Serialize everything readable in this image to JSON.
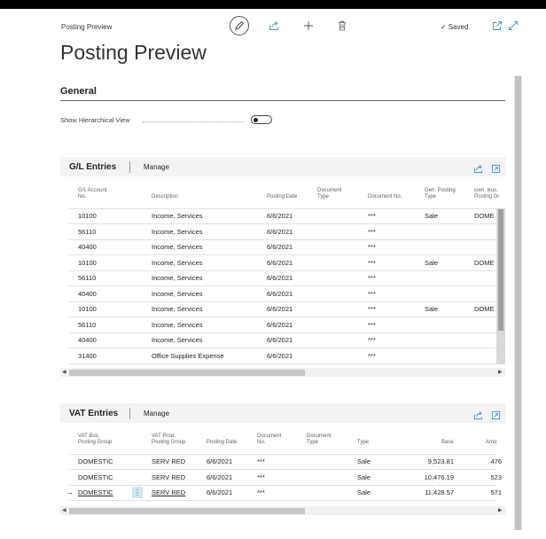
{
  "header": {
    "breadcrumb": "Posting Preview",
    "title": "Posting Preview",
    "status": "Saved",
    "status_icon": "check-icon"
  },
  "general": {
    "title": "General",
    "hier_label": "Show Hierarchical View",
    "hier_value": false
  },
  "gl": {
    "title": "G/L Entries",
    "manage": "Manage",
    "headers": {
      "acc1": "G/L Account",
      "acc2": "No.",
      "desc": "Description",
      "date": "Posting Date",
      "dtype1": "Document",
      "dtype2": "Type",
      "docno": "Document No.",
      "gpt1": "Gen. Posting",
      "gpt2": "Type",
      "gbpg1": "Gen. Bus.",
      "gbpg2": "Posting Gr"
    },
    "rows": [
      {
        "acc": "10100",
        "desc": "Income, Services",
        "date": "6/6/2021",
        "doc": "***",
        "type": "Sale",
        "bus": "DOME"
      },
      {
        "acc": "56110",
        "desc": "Income, Services",
        "date": "6/6/2021",
        "doc": "***",
        "type": "",
        "bus": ""
      },
      {
        "acc": "40400",
        "desc": "Income, Services",
        "date": "6/6/2021",
        "doc": "***",
        "type": "",
        "bus": ""
      },
      {
        "acc": "10100",
        "desc": "Income, Services",
        "date": "6/6/2021",
        "doc": "***",
        "type": "Sale",
        "bus": "DOME"
      },
      {
        "acc": "56110",
        "desc": "Income, Services",
        "date": "6/6/2021",
        "doc": "***",
        "type": "",
        "bus": ""
      },
      {
        "acc": "40400",
        "desc": "Income, Services",
        "date": "6/6/2021",
        "doc": "***",
        "type": "",
        "bus": ""
      },
      {
        "acc": "10100",
        "desc": "Income, Services",
        "date": "6/6/2021",
        "doc": "***",
        "type": "Sale",
        "bus": "DOME"
      },
      {
        "acc": "56110",
        "desc": "Income, Services",
        "date": "6/6/2021",
        "doc": "***",
        "type": "",
        "bus": ""
      },
      {
        "acc": "40400",
        "desc": "Income, Services",
        "date": "6/6/2021",
        "doc": "***",
        "type": "",
        "bus": ""
      },
      {
        "acc": "31400",
        "desc": "Office Supplies Expense",
        "date": "6/6/2021",
        "doc": "***",
        "type": "",
        "bus": ""
      }
    ]
  },
  "vat": {
    "title": "VAT Entries",
    "manage": "Manage",
    "headers": {
      "bus1": "VAT Bus.",
      "bus2": "Posting Group",
      "prod1": "VAT Prod.",
      "prod2": "Posting Group",
      "date": "Posting Date",
      "docno1": "Document",
      "docno2": "No.",
      "dtype1": "Document",
      "dtype2": "Type",
      "type": "Type",
      "base": "Base",
      "amount": "Amo"
    },
    "rows": [
      {
        "bus": "DOMESTIC",
        "prod": "SERV RED",
        "date": "6/6/2021",
        "doc": "***",
        "type": "Sale",
        "base": "9,523.81",
        "amount": "476"
      },
      {
        "bus": "DOMESTIC",
        "prod": "SERV RED",
        "date": "6/6/2021",
        "doc": "***",
        "type": "Sale",
        "base": "10,476.19",
        "amount": "523"
      },
      {
        "bus": "DOMESTIC",
        "prod": "SERV RED",
        "date": "6/6/2021",
        "doc": "***",
        "type": "Sale",
        "base": "11,428.57",
        "amount": "571"
      }
    ],
    "selected_row": 2
  }
}
